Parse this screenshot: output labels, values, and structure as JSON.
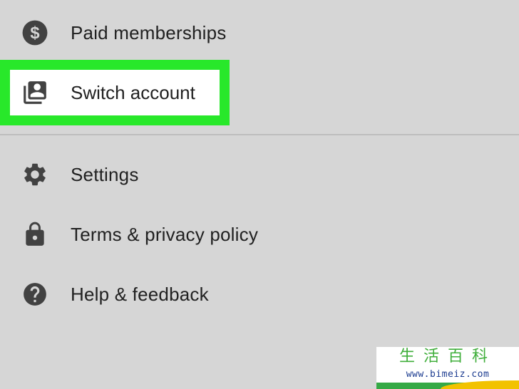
{
  "menu": {
    "items": [
      {
        "label": "Paid memberships",
        "icon": "dollar-circle-icon"
      },
      {
        "label": "Switch account",
        "icon": "switch-account-icon",
        "highlighted": true
      },
      {
        "label": "Settings",
        "icon": "gear-icon"
      },
      {
        "label": "Terms & privacy policy",
        "icon": "lock-icon"
      },
      {
        "label": "Help & feedback",
        "icon": "help-circle-icon"
      }
    ]
  },
  "colors": {
    "background": "#d6d6d6",
    "highlight": "#28e82a",
    "icon": "#424242",
    "text": "#212121"
  },
  "watermark": {
    "chinese": "生活百科",
    "url": "www.bimeiz.com"
  }
}
